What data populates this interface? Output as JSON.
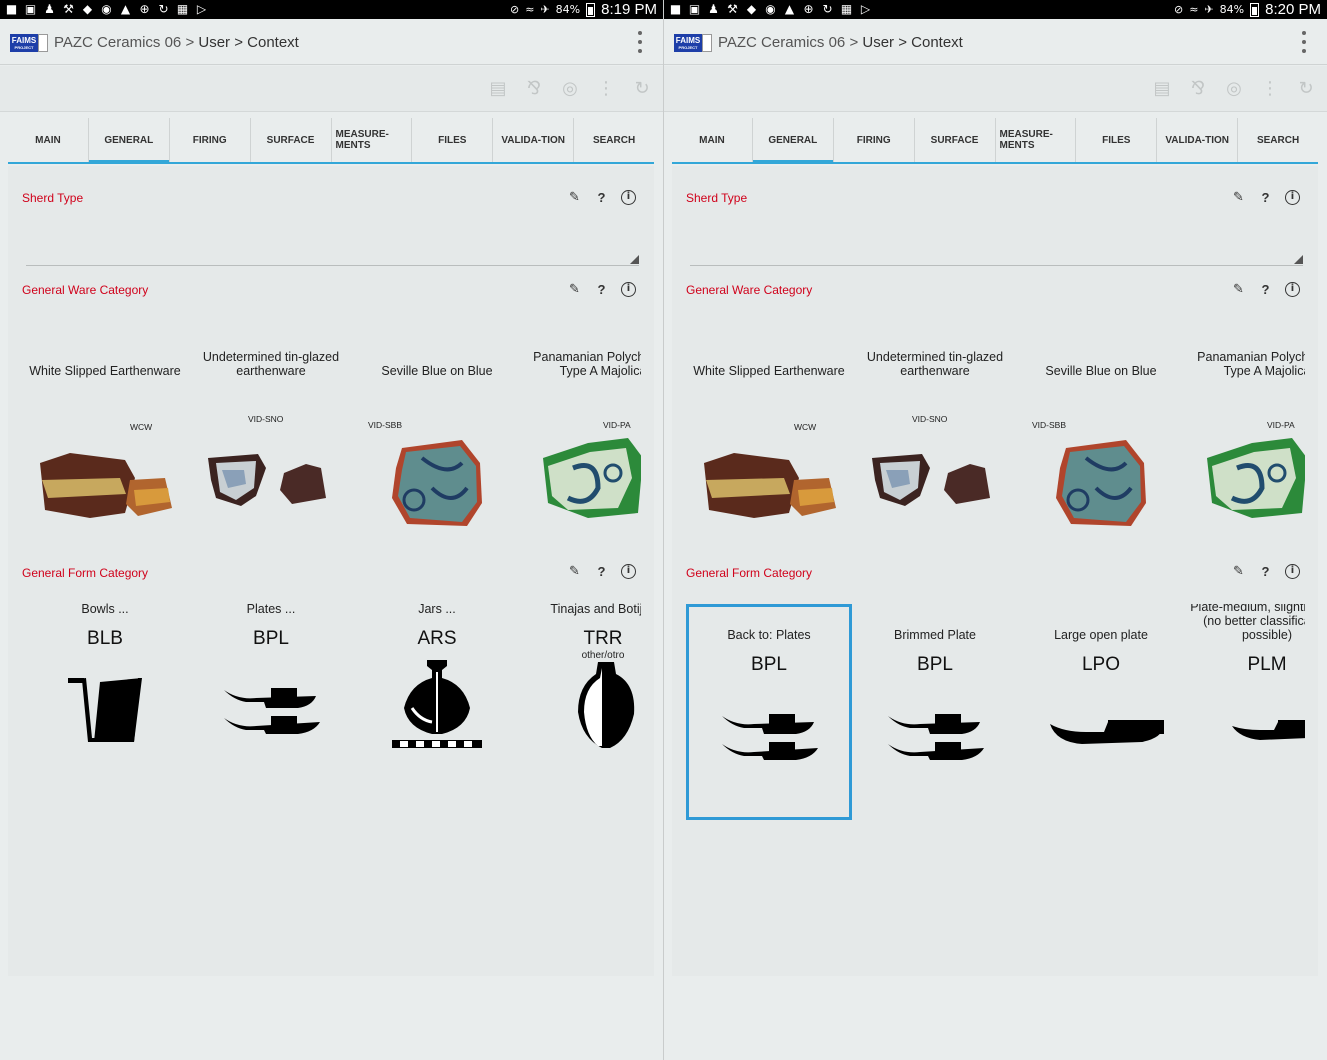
{
  "screens": [
    {
      "status": {
        "battery": "84%",
        "time": "8:19 PM"
      },
      "appbar": {
        "project": "PAZC Ceramics 06",
        "sep1": ">",
        "user": "User",
        "sep2": ">",
        "page": "Context",
        "logo_text": "FAIMS",
        "logo_sub": "PROJECT"
      },
      "tabs": [
        {
          "label": "MAIN"
        },
        {
          "label": "GENERAL",
          "active": true
        },
        {
          "label": "FIRING"
        },
        {
          "label": "SURFACE"
        },
        {
          "label": "MEASURE-MENTS"
        },
        {
          "label": "FILES"
        },
        {
          "label": "VALIDA-TION"
        },
        {
          "label": "SEARCH"
        }
      ],
      "fields": {
        "sherd_type": {
          "label": "Sherd Type",
          "value": ""
        },
        "ware_category": {
          "label": "General Ware Category",
          "options": [
            {
              "title": "White Slipped Earthenware",
              "code": "WCW"
            },
            {
              "title": "Undetermined tin-glazed earthenware",
              "code": "VID-SNO"
            },
            {
              "title": "Seville Blue on Blue",
              "code": "VID-SBB"
            },
            {
              "title": "Panamanian Polychrome Type A Majolica",
              "code": "VID-PA"
            }
          ]
        },
        "form_category": {
          "label": "General Form Category",
          "options": [
            {
              "title": "Bowls ...",
              "code": "BLB",
              "sub": "",
              "shape": "bowl"
            },
            {
              "title": "Plates ...",
              "code": "BPL",
              "sub": "",
              "shape": "plates"
            },
            {
              "title": "Jars ...",
              "code": "ARS",
              "sub": "",
              "shape": "jar"
            },
            {
              "title": "Tinajas and Botijas",
              "code": "TRR",
              "sub": "other/otro",
              "shape": "tinaja"
            }
          ]
        }
      }
    },
    {
      "status": {
        "battery": "84%",
        "time": "8:20 PM"
      },
      "appbar": {
        "project": "PAZC Ceramics 06",
        "sep1": ">",
        "user": "User",
        "sep2": ">",
        "page": "Context",
        "logo_text": "FAIMS",
        "logo_sub": "PROJECT"
      },
      "tabs": [
        {
          "label": "MAIN"
        },
        {
          "label": "GENERAL",
          "active": true
        },
        {
          "label": "FIRING"
        },
        {
          "label": "SURFACE"
        },
        {
          "label": "MEASURE-MENTS"
        },
        {
          "label": "FILES"
        },
        {
          "label": "VALIDA-TION"
        },
        {
          "label": "SEARCH"
        }
      ],
      "fields": {
        "sherd_type": {
          "label": "Sherd Type",
          "value": ""
        },
        "ware_category": {
          "label": "General Ware Category",
          "options": [
            {
              "title": "White Slipped Earthenware",
              "code": "WCW"
            },
            {
              "title": "Undetermined tin-glazed earthenware",
              "code": "VID-SNO"
            },
            {
              "title": "Seville Blue on Blue",
              "code": "VID-SBB"
            },
            {
              "title": "Panamanian Polychrome Type A Majolica",
              "code": "VID-PA"
            }
          ]
        },
        "form_category": {
          "label": "General Form Category",
          "options": [
            {
              "title": "Back to: Plates",
              "code": "BPL",
              "sub": "",
              "shape": "plates",
              "selected": true
            },
            {
              "title": "Brimmed Plate",
              "code": "BPL",
              "sub": "",
              "shape": "plates"
            },
            {
              "title": "Large open plate",
              "code": "LPO",
              "sub": "",
              "shape": "largeplate"
            },
            {
              "title": "Plate-medium, slightly open (no better classification possible)",
              "code": "PLM",
              "sub": "",
              "shape": "medplate"
            }
          ]
        }
      }
    }
  ],
  "colors": {
    "accent": "#33a7d8",
    "label_red": "#d0021b",
    "selected_border": "#2f9ad6"
  }
}
